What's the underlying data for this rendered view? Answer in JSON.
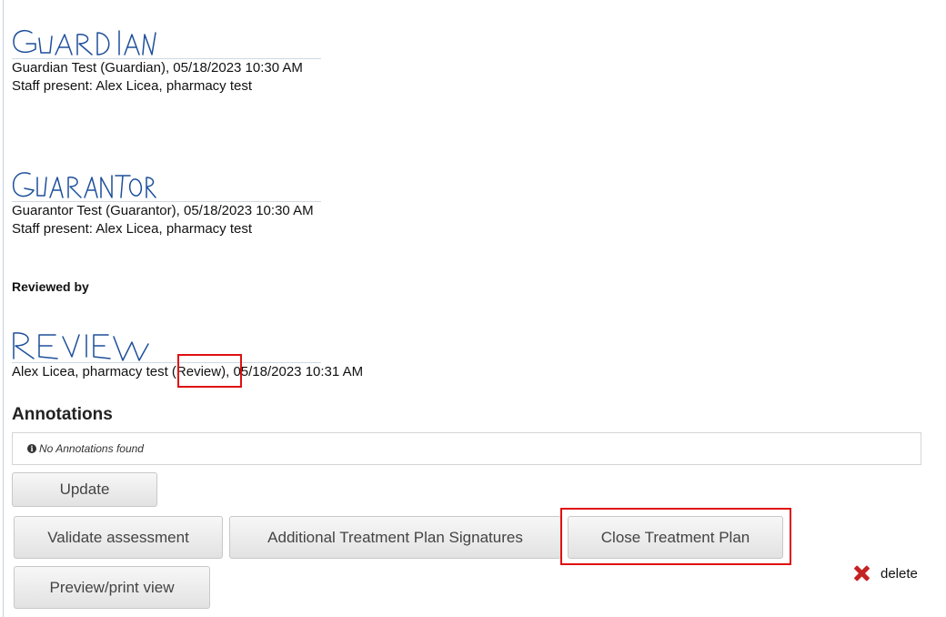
{
  "signatures": [
    {
      "handwriting": "GUARDIAN",
      "line1": "Guardian Test (Guardian), 05/18/2023 10:30 AM",
      "line2": "Staff present: Alex Licea, pharmacy test"
    },
    {
      "handwriting": "GUARANTOR",
      "line1": "Guarantor Test (Guarantor), 05/18/2023 10:30 AM",
      "line2": "Staff present: Alex Licea, pharmacy test"
    }
  ],
  "reviewed": {
    "heading": "Reviewed by",
    "handwriting": "REVIEW",
    "name": "Alex Licea, pharmacy test",
    "role": "(Review)",
    "timestamp": "05/18/2023 10:31 AM"
  },
  "annotations": {
    "heading": "Annotations",
    "empty_text": "No Annotations found",
    "icon": "info-icon"
  },
  "buttons": {
    "update": "Update",
    "validate": "Validate assessment",
    "additional": "Additional Treatment Plan Signatures",
    "close": "Close Treatment Plan",
    "preview": "Preview/print view",
    "delete": "delete"
  },
  "colors": {
    "highlight": "#e01010",
    "ink": "#1d4f9a",
    "delete_icon": "#c42323"
  }
}
